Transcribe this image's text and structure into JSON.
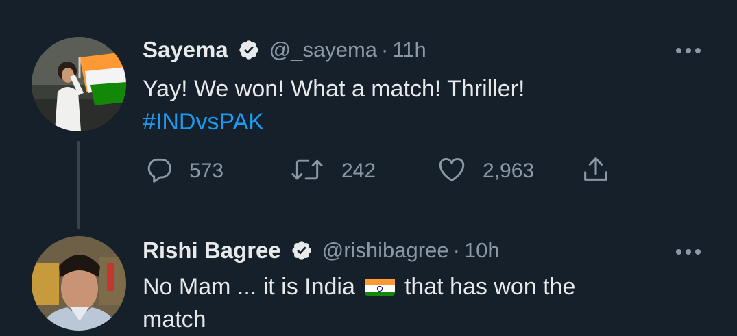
{
  "colors": {
    "background": "#15202b",
    "muted": "#8b98a5",
    "text": "#e7e9ea",
    "link": "#1d9bf0",
    "divider": "#38444d"
  },
  "tweet1": {
    "name": "Sayema",
    "handle": "@_sayema",
    "separator": "·",
    "time": "11h",
    "text_line1": "Yay! We won! What a match! Thriller!",
    "hashtag": "#INDvsPAK",
    "replies": "573",
    "retweets": "242",
    "likes": "2,963",
    "icons": [
      "verified-icon",
      "more-icon",
      "reply-icon",
      "retweet-icon",
      "like-icon",
      "share-icon"
    ]
  },
  "tweet2": {
    "name": "Rishi Bagree",
    "handle": "@rishibagree",
    "separator": "·",
    "time": "10h",
    "text_before_flag": "No Mam ... it is India",
    "flag_emoji": "india-flag",
    "text_after_flag": "that has won the",
    "text_line2": "match",
    "icons": [
      "verified-icon",
      "more-icon"
    ]
  }
}
